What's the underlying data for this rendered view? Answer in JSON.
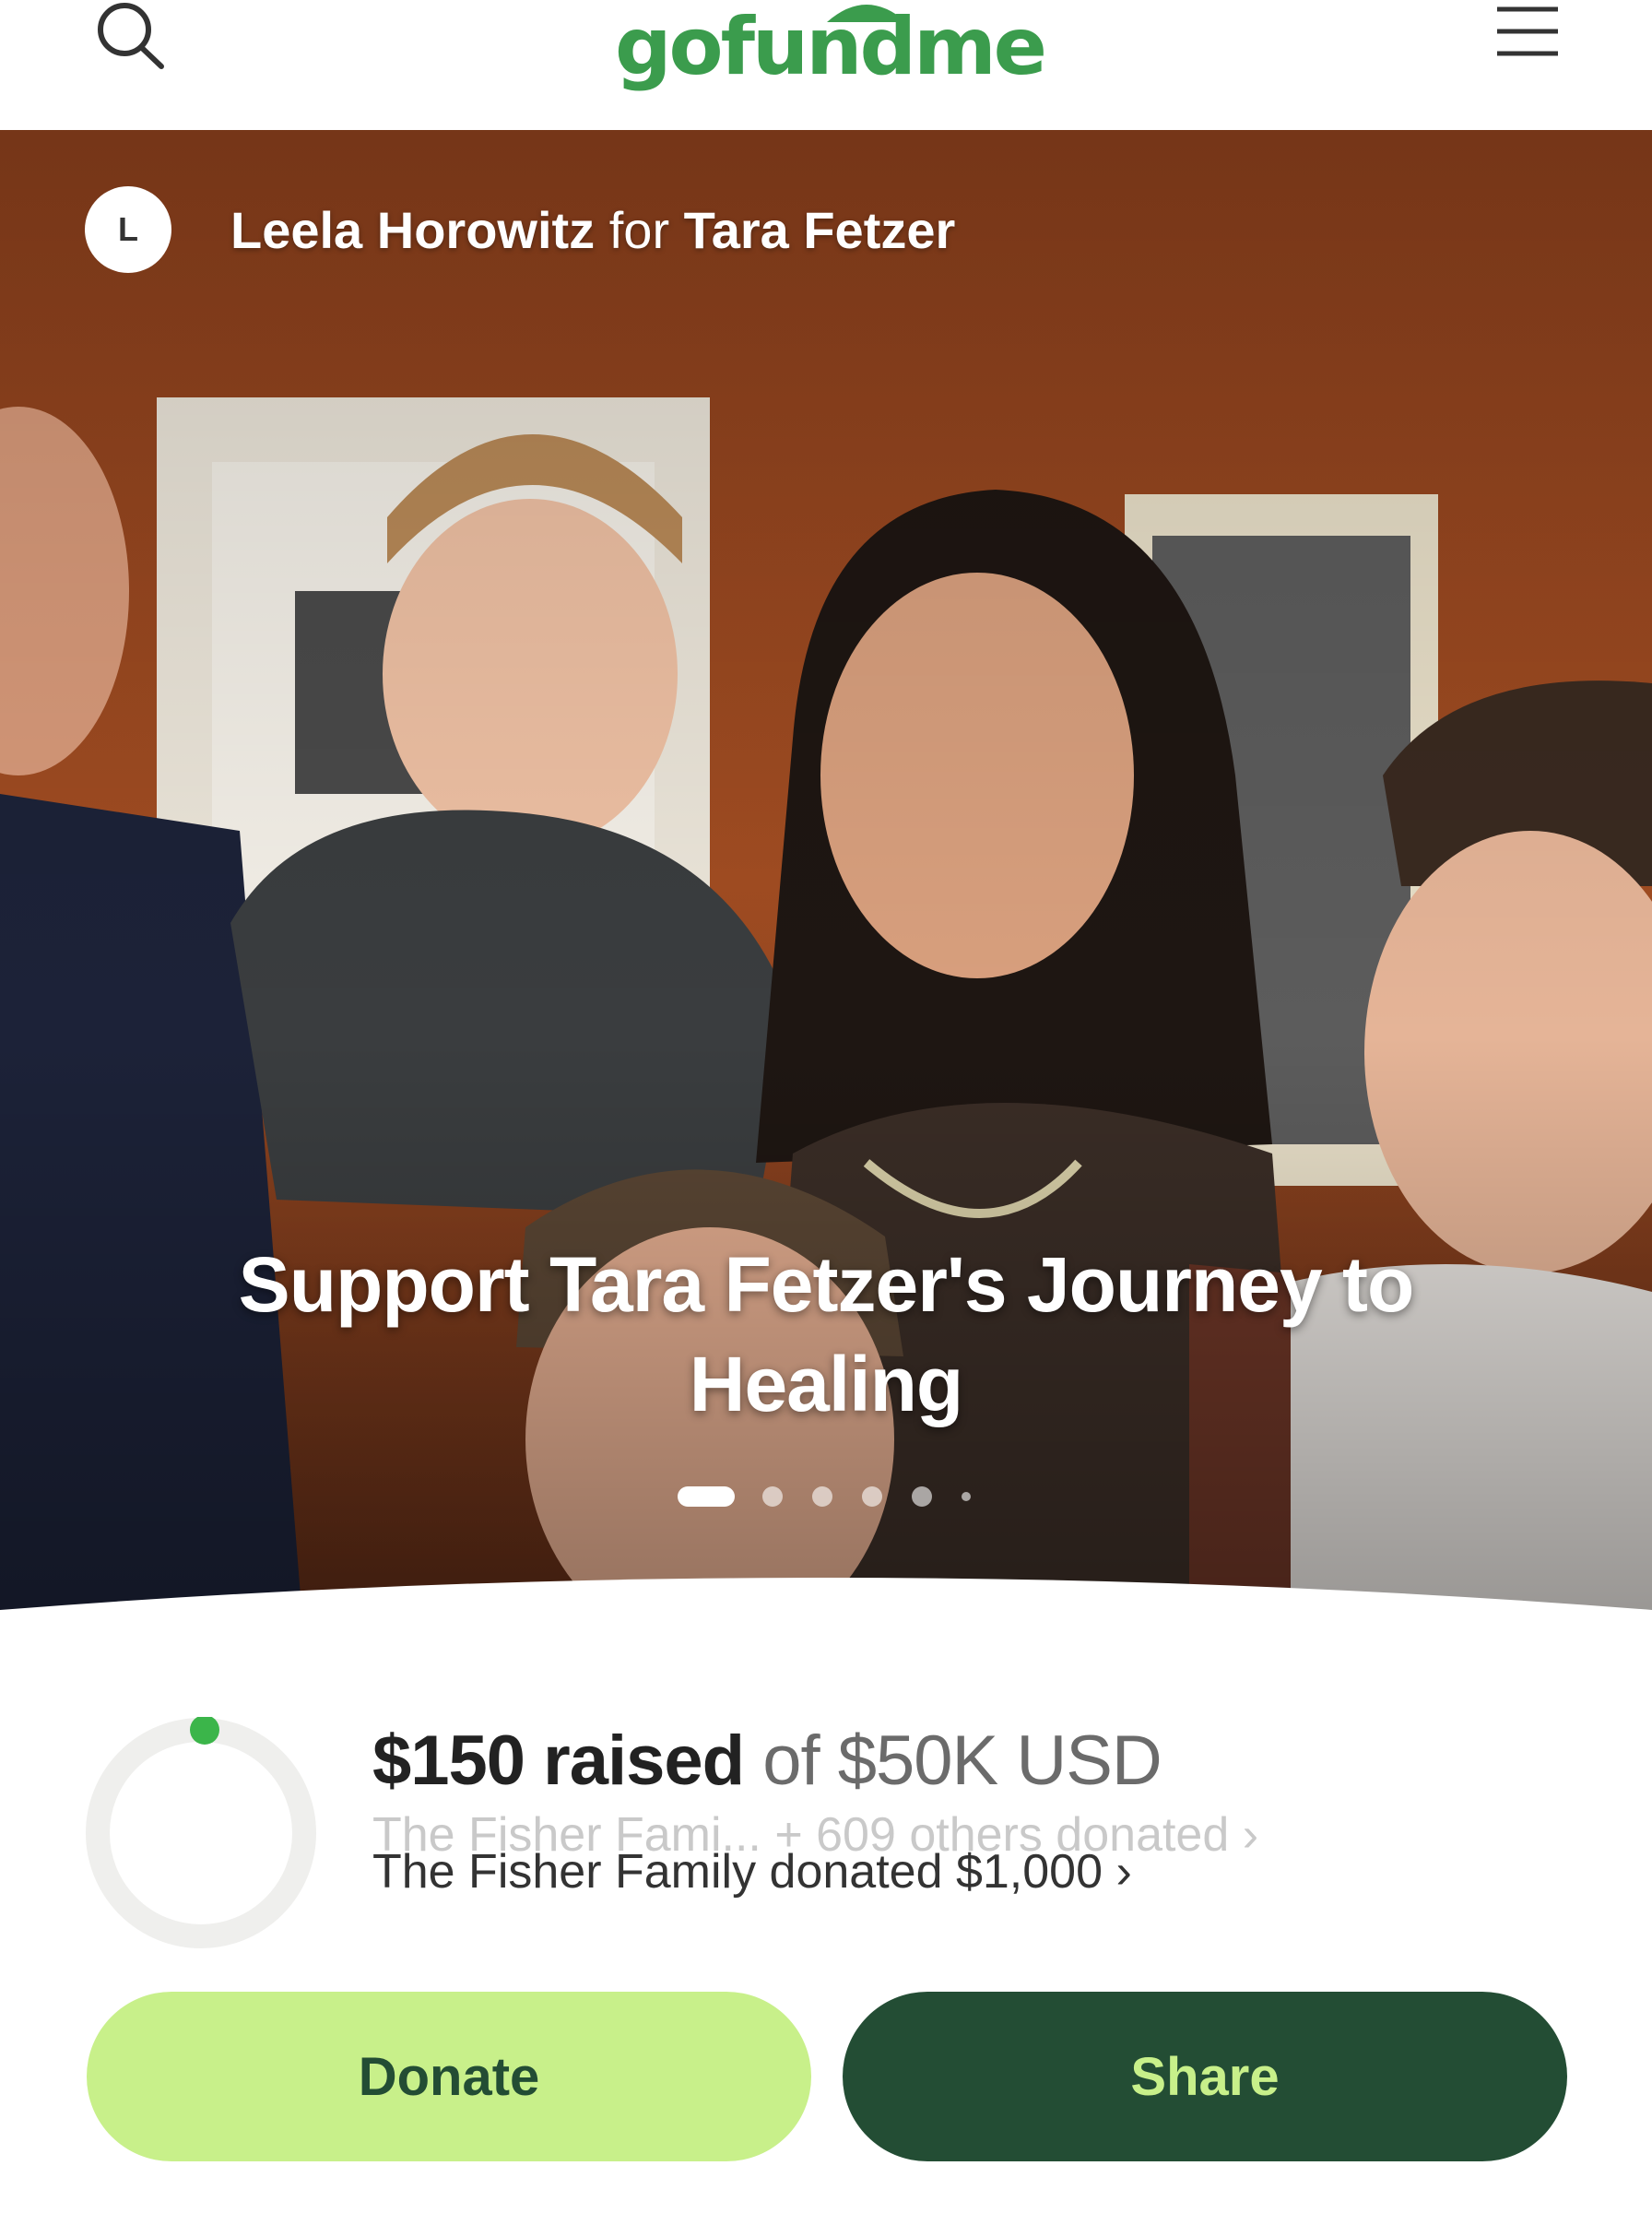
{
  "header": {
    "logo_text": "gofundme",
    "search_icon": "search-icon",
    "menu_icon": "hamburger-menu-icon",
    "brand_color": "#3b9c4d"
  },
  "organizer": {
    "avatar_initial": "L",
    "name": "Leela Horowitz",
    "connector": "for",
    "beneficiary": "Tara Fetzer"
  },
  "campaign": {
    "title": "Support Tara Fetzer's Journey to Healing",
    "slide_count": 6,
    "active_slide": 1
  },
  "progress": {
    "raised": "$150 raised",
    "goal_text": "of $50K USD",
    "fraction": 0.003,
    "donors_ghost": "The Fisher Fami... + 609 others donated",
    "donors": "The Fisher Family donated $1,000"
  },
  "actions": {
    "donate_label": "Donate",
    "share_label": "Share",
    "donate_color": "#c8f08a",
    "share_color": "#234d34"
  }
}
